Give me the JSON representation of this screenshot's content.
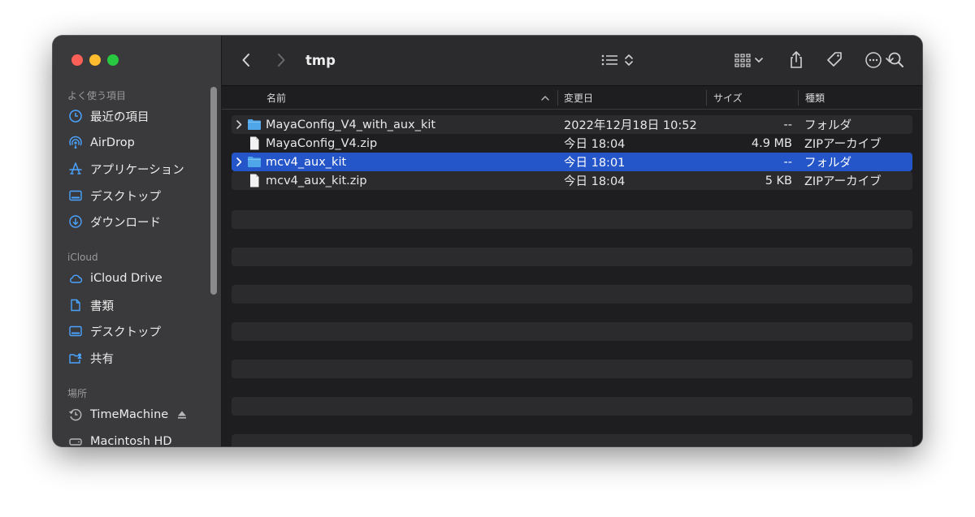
{
  "window": {
    "title": "tmp"
  },
  "sidebar": {
    "sections": [
      {
        "title": "よく使う項目",
        "items": [
          {
            "label": "最近の項目",
            "icon": "clock-icon"
          },
          {
            "label": "AirDrop",
            "icon": "airdrop-icon"
          },
          {
            "label": "アプリケーション",
            "icon": "applications-icon"
          },
          {
            "label": "デスクトップ",
            "icon": "desktop-icon"
          },
          {
            "label": "ダウンロード",
            "icon": "download-icon"
          }
        ]
      },
      {
        "title": "iCloud",
        "items": [
          {
            "label": "iCloud Drive",
            "icon": "cloud-icon"
          },
          {
            "label": "書類",
            "icon": "document-icon"
          },
          {
            "label": "デスクトップ",
            "icon": "desktop-icon"
          },
          {
            "label": "共有",
            "icon": "shared-folder-icon"
          }
        ]
      },
      {
        "title": "場所",
        "items": [
          {
            "label": "TimeMachine",
            "icon": "timemachine-icon"
          },
          {
            "label": "Macintosh HD",
            "icon": "disk-icon"
          }
        ]
      }
    ]
  },
  "columns": {
    "name": "名前",
    "date": "変更日",
    "size": "サイズ",
    "kind": "種類"
  },
  "files": [
    {
      "name": "MayaConfig_V4_with_aux_kit",
      "date": "2022年12月18日 10:52",
      "size": "--",
      "kind": "フォルダ",
      "type": "folder",
      "selected": false
    },
    {
      "name": "MayaConfig_V4.zip",
      "date": "今日 18:04",
      "size": "4.9 MB",
      "kind": "ZIPアーカイブ",
      "type": "file",
      "selected": false
    },
    {
      "name": "mcv4_aux_kit",
      "date": "今日 18:01",
      "size": "--",
      "kind": "フォルダ",
      "type": "folder",
      "selected": true
    },
    {
      "name": "mcv4_aux_kit.zip",
      "date": "今日 18:04",
      "size": "5 KB",
      "kind": "ZIPアーカイブ",
      "type": "file",
      "selected": false
    }
  ],
  "colors": {
    "accent": "#2455c9",
    "sidebar_icon": "#4aa3ff",
    "folder": "#4fa6e8"
  }
}
